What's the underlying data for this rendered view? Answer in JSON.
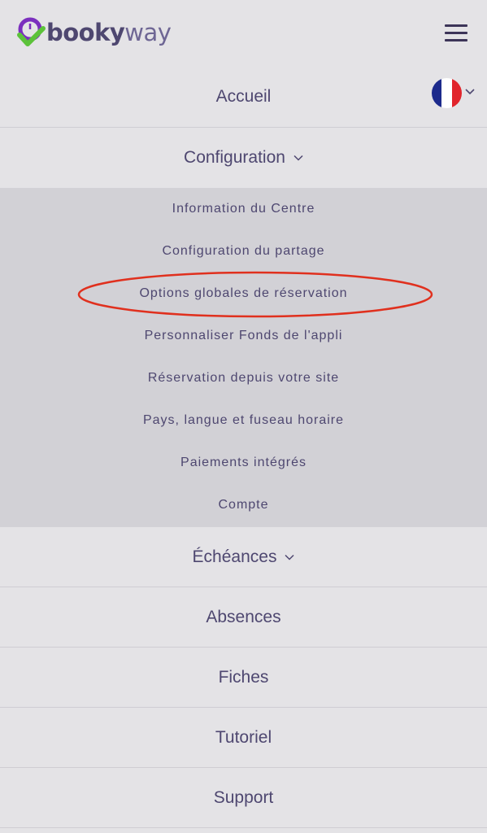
{
  "app": {
    "logo_part1": "booky",
    "logo_part2": "way"
  },
  "header": {
    "menu_icon": "hamburger-icon",
    "language_flag": "france-flag-icon"
  },
  "menu": {
    "accueil": "Accueil",
    "configuration": "Configuration",
    "echeances": "Échéances",
    "absences": "Absences",
    "fiches": "Fiches",
    "tutoriel": "Tutoriel",
    "support": "Support"
  },
  "submenu": {
    "items": [
      "Information du Centre",
      "Configuration du partage",
      "Options globales de réservation",
      "Personnaliser Fonds de l'appli",
      "Réservation depuis votre site",
      "Pays, langue et fuseau horaire",
      "Paiements intégrés",
      "Compte"
    ]
  },
  "colors": {
    "background": "#e4e3e6",
    "submenu_background": "#d2d1d6",
    "text": "#4e4770",
    "logo_purple": "#7b2fbe",
    "logo_green": "#5cc23a",
    "highlight_red": "#e0301e",
    "flag_blue": "#1c2a8c",
    "flag_white": "#ffffff",
    "flag_red": "#e1252c"
  }
}
